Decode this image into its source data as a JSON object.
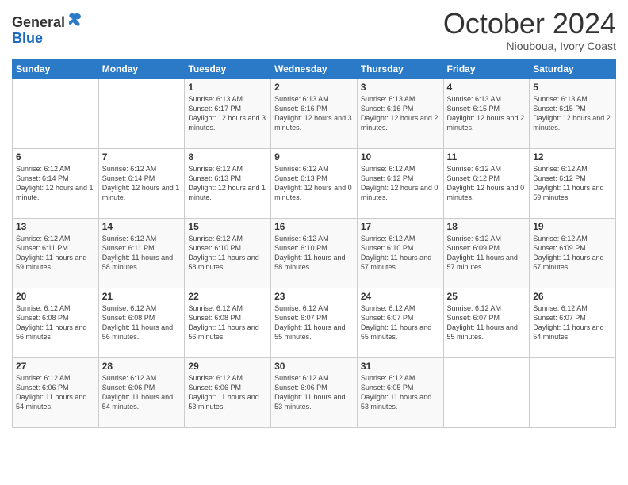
{
  "logo": {
    "general": "General",
    "blue": "Blue"
  },
  "header": {
    "month": "October 2024",
    "location": "Niouboua, Ivory Coast"
  },
  "days_of_week": [
    "Sunday",
    "Monday",
    "Tuesday",
    "Wednesday",
    "Thursday",
    "Friday",
    "Saturday"
  ],
  "weeks": [
    [
      {
        "day": "",
        "info": ""
      },
      {
        "day": "",
        "info": ""
      },
      {
        "day": "1",
        "info": "Sunrise: 6:13 AM\nSunset: 6:17 PM\nDaylight: 12 hours and 3 minutes."
      },
      {
        "day": "2",
        "info": "Sunrise: 6:13 AM\nSunset: 6:16 PM\nDaylight: 12 hours and 3 minutes."
      },
      {
        "day": "3",
        "info": "Sunrise: 6:13 AM\nSunset: 6:16 PM\nDaylight: 12 hours and 2 minutes."
      },
      {
        "day": "4",
        "info": "Sunrise: 6:13 AM\nSunset: 6:15 PM\nDaylight: 12 hours and 2 minutes."
      },
      {
        "day": "5",
        "info": "Sunrise: 6:13 AM\nSunset: 6:15 PM\nDaylight: 12 hours and 2 minutes."
      }
    ],
    [
      {
        "day": "6",
        "info": "Sunrise: 6:12 AM\nSunset: 6:14 PM\nDaylight: 12 hours and 1 minute."
      },
      {
        "day": "7",
        "info": "Sunrise: 6:12 AM\nSunset: 6:14 PM\nDaylight: 12 hours and 1 minute."
      },
      {
        "day": "8",
        "info": "Sunrise: 6:12 AM\nSunset: 6:13 PM\nDaylight: 12 hours and 1 minute."
      },
      {
        "day": "9",
        "info": "Sunrise: 6:12 AM\nSunset: 6:13 PM\nDaylight: 12 hours and 0 minutes."
      },
      {
        "day": "10",
        "info": "Sunrise: 6:12 AM\nSunset: 6:12 PM\nDaylight: 12 hours and 0 minutes."
      },
      {
        "day": "11",
        "info": "Sunrise: 6:12 AM\nSunset: 6:12 PM\nDaylight: 12 hours and 0 minutes."
      },
      {
        "day": "12",
        "info": "Sunrise: 6:12 AM\nSunset: 6:12 PM\nDaylight: 11 hours and 59 minutes."
      }
    ],
    [
      {
        "day": "13",
        "info": "Sunrise: 6:12 AM\nSunset: 6:11 PM\nDaylight: 11 hours and 59 minutes."
      },
      {
        "day": "14",
        "info": "Sunrise: 6:12 AM\nSunset: 6:11 PM\nDaylight: 11 hours and 58 minutes."
      },
      {
        "day": "15",
        "info": "Sunrise: 6:12 AM\nSunset: 6:10 PM\nDaylight: 11 hours and 58 minutes."
      },
      {
        "day": "16",
        "info": "Sunrise: 6:12 AM\nSunset: 6:10 PM\nDaylight: 11 hours and 58 minutes."
      },
      {
        "day": "17",
        "info": "Sunrise: 6:12 AM\nSunset: 6:10 PM\nDaylight: 11 hours and 57 minutes."
      },
      {
        "day": "18",
        "info": "Sunrise: 6:12 AM\nSunset: 6:09 PM\nDaylight: 11 hours and 57 minutes."
      },
      {
        "day": "19",
        "info": "Sunrise: 6:12 AM\nSunset: 6:09 PM\nDaylight: 11 hours and 57 minutes."
      }
    ],
    [
      {
        "day": "20",
        "info": "Sunrise: 6:12 AM\nSunset: 6:08 PM\nDaylight: 11 hours and 56 minutes."
      },
      {
        "day": "21",
        "info": "Sunrise: 6:12 AM\nSunset: 6:08 PM\nDaylight: 11 hours and 56 minutes."
      },
      {
        "day": "22",
        "info": "Sunrise: 6:12 AM\nSunset: 6:08 PM\nDaylight: 11 hours and 56 minutes."
      },
      {
        "day": "23",
        "info": "Sunrise: 6:12 AM\nSunset: 6:07 PM\nDaylight: 11 hours and 55 minutes."
      },
      {
        "day": "24",
        "info": "Sunrise: 6:12 AM\nSunset: 6:07 PM\nDaylight: 11 hours and 55 minutes."
      },
      {
        "day": "25",
        "info": "Sunrise: 6:12 AM\nSunset: 6:07 PM\nDaylight: 11 hours and 55 minutes."
      },
      {
        "day": "26",
        "info": "Sunrise: 6:12 AM\nSunset: 6:07 PM\nDaylight: 11 hours and 54 minutes."
      }
    ],
    [
      {
        "day": "27",
        "info": "Sunrise: 6:12 AM\nSunset: 6:06 PM\nDaylight: 11 hours and 54 minutes."
      },
      {
        "day": "28",
        "info": "Sunrise: 6:12 AM\nSunset: 6:06 PM\nDaylight: 11 hours and 54 minutes."
      },
      {
        "day": "29",
        "info": "Sunrise: 6:12 AM\nSunset: 6:06 PM\nDaylight: 11 hours and 53 minutes."
      },
      {
        "day": "30",
        "info": "Sunrise: 6:12 AM\nSunset: 6:06 PM\nDaylight: 11 hours and 53 minutes."
      },
      {
        "day": "31",
        "info": "Sunrise: 6:12 AM\nSunset: 6:05 PM\nDaylight: 11 hours and 53 minutes."
      },
      {
        "day": "",
        "info": ""
      },
      {
        "day": "",
        "info": ""
      }
    ]
  ]
}
